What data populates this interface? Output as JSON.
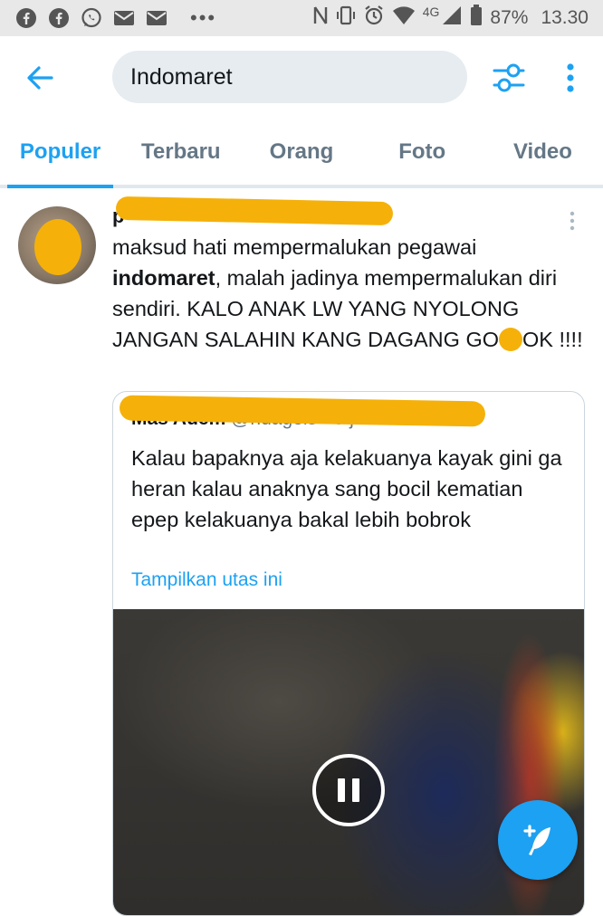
{
  "status_bar": {
    "battery": "87%",
    "time": "13.30",
    "network": "4G",
    "icons": [
      "facebook-icon",
      "facebook-icon",
      "whatsapp-icon",
      "mail-icon",
      "mail-icon",
      "more-dots-icon",
      "nfc-icon",
      "vibrate-icon",
      "alarm-icon",
      "wifi-icon",
      "signal-icon",
      "battery-icon"
    ]
  },
  "search": {
    "query": "Indomaret"
  },
  "tabs": [
    {
      "label": "Populer",
      "active": true
    },
    {
      "label": "Terbaru",
      "active": false
    },
    {
      "label": "Orang",
      "active": false
    },
    {
      "label": "Foto",
      "active": false
    },
    {
      "label": "Video",
      "active": false
    }
  ],
  "tweet": {
    "text_before_bold": "maksud hati mempermalukan pegawai ",
    "bold": "indomaret",
    "text_after_bold": ", malah jadinya mempermalukan diri sendiri. KALO ANAK LW YANG NYOLONG JANGAN SALAHIN KANG DAGANG GO",
    "text_tail": "OK !!!!",
    "author_partial": "p",
    "quote": {
      "author_name": "Mas Adem",
      "author_handle": "@ndagels",
      "time": "· 9 jam",
      "text": "Kalau bapaknya aja kelakuanya kayak gini ga heran kalau anaknya sang bocil kematian epep kelakuanya bakal lebih bobrok",
      "show_thread": "Tampilkan utas ini"
    }
  },
  "colors": {
    "accent": "#1da1f2",
    "redaction": "#f5b10a",
    "text": "#14171a",
    "muted": "#657786"
  }
}
